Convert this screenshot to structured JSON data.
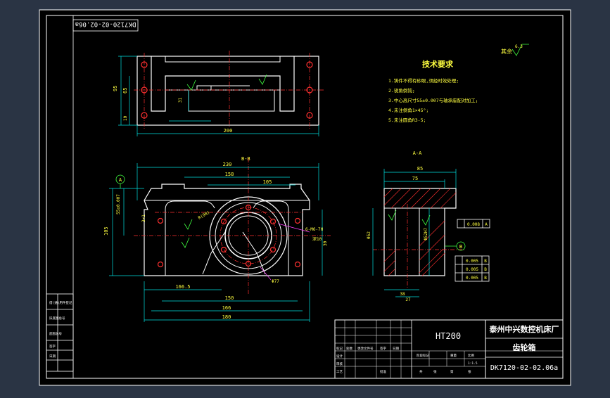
{
  "drawing_code_rotated": "DK7120-02-02.06a",
  "top_view_dims": {
    "overall_width": "200",
    "height_left": "95",
    "height_inner": "65",
    "dim_small": "10",
    "dim_b": "31"
  },
  "tech_requirements": {
    "title": "技术要求",
    "items": [
      "1.铸件不得有砂眼,须经时效处理;",
      "2.锐角倒钝;",
      "3.中心高尺寸55±0.007与轴承座配对加工;",
      "4.未注倒角1×45°;",
      "5.未注圆角R3-5;"
    ]
  },
  "surface_finish": {
    "label": "其余",
    "value": "6.3"
  },
  "front_view": {
    "section_label": "B-B",
    "dims_top": [
      "230",
      "158",
      "105"
    ],
    "dims_bottom": [
      "166.5",
      "150",
      "166",
      "180"
    ],
    "dim_height": "105",
    "dim_center": "55±0.007",
    "dim_right": "30",
    "hole_callout": "6-M6-7H",
    "hole_note": "深10",
    "datum": "A",
    "dia": "Φ77",
    "small_dim": "3×1",
    "bolt_circle": "R(98)"
  },
  "section_view": {
    "label": "A-A",
    "dims": [
      "85",
      "75",
      "38",
      "27"
    ],
    "dim_vertical": "Φ52",
    "dim_inner": "Φ52H7",
    "datum": "B",
    "fcf_right": {
      "tol": "0.008",
      "datum": "A"
    },
    "fcf_bottom": [
      {
        "tol": "0.005",
        "datum": "B"
      },
      {
        "tol": "0.005",
        "datum": "B"
      },
      {
        "tol": "0.005",
        "datum": "B"
      }
    ]
  },
  "title_block": {
    "material": "HT200",
    "company": "泰州中兴数控机床厂",
    "part_name": "齿轮箱",
    "drawing_number": "DK7120-02-02.06a",
    "scale": "1:1.5",
    "sheet_labels": [
      "共",
      "张",
      "第",
      "张"
    ],
    "row_labels": [
      "标记",
      "处数",
      "更改文件号",
      "签字",
      "日期"
    ],
    "sub_row_labels": [
      "设计",
      "审核",
      "工艺",
      "批准"
    ],
    "stage_labels": [
      "阶段标记",
      "重量",
      "比例"
    ]
  },
  "side_table": {
    "rows": [
      "借(通)用件登记",
      "旧底图总号",
      "底图总号",
      "签字",
      "日期"
    ]
  },
  "colors": {
    "background": "#2a3444",
    "sheet": "#000000",
    "outline": "#ffffff",
    "center": "#ff3030",
    "dim": "#00e0e0",
    "text": "#ffff40",
    "hatch": "#ff3030",
    "green": "#40ff40",
    "mag": "#ff40ff"
  }
}
